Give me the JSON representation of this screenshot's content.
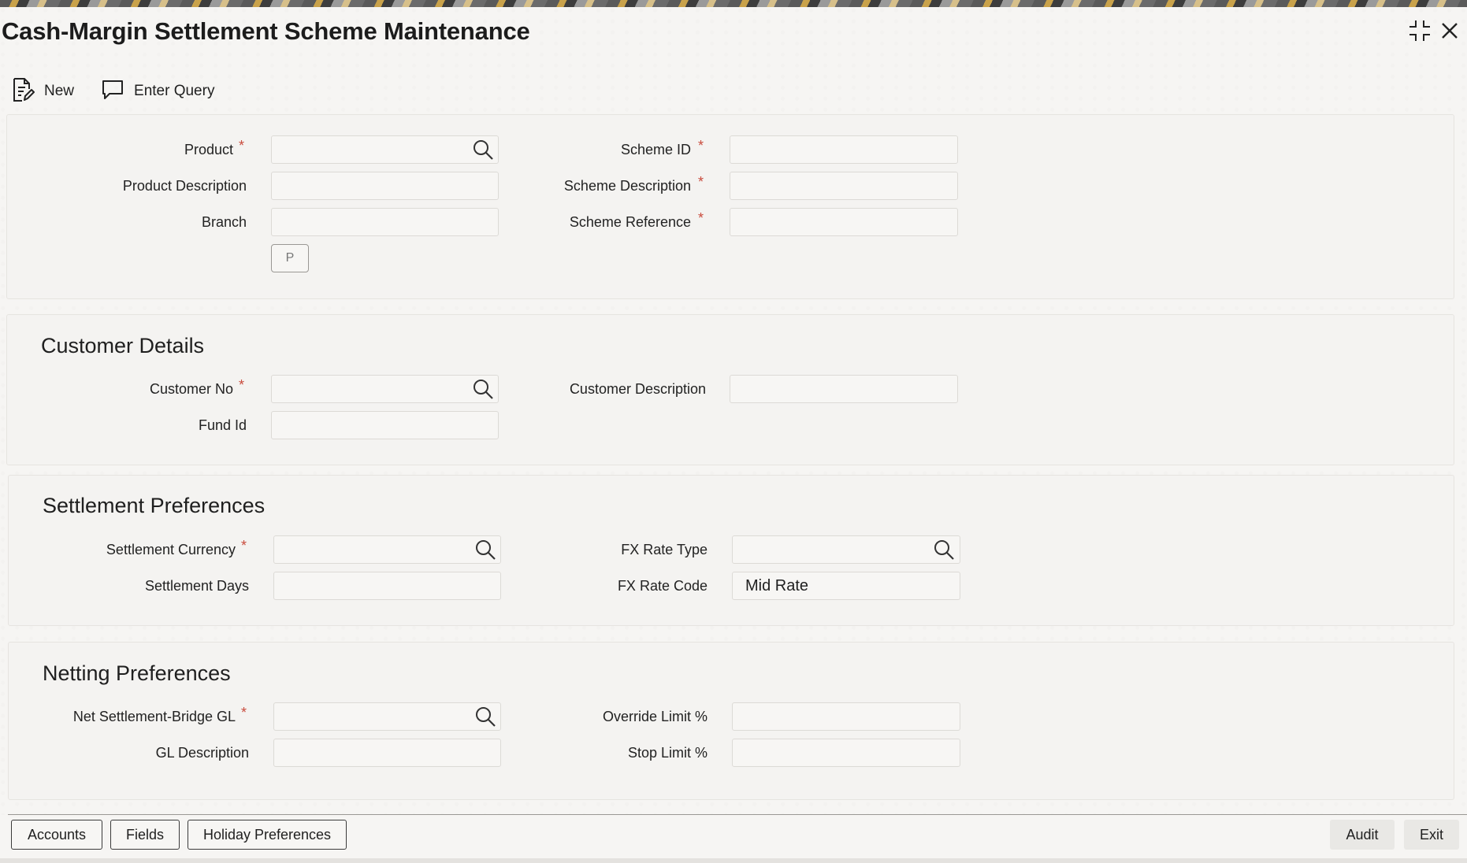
{
  "window": {
    "title": "Cash-Margin Settlement Scheme Maintenance"
  },
  "toolbar": {
    "new_label": "New",
    "enter_query_label": "Enter Query"
  },
  "header_panel": {
    "product_label": "Product",
    "product_value": "",
    "product_description_label": "Product Description",
    "product_description_value": "",
    "branch_label": "Branch",
    "branch_value": "",
    "p_button_label": "P",
    "scheme_id_label": "Scheme ID",
    "scheme_id_value": "",
    "scheme_description_label": "Scheme Description",
    "scheme_description_value": "",
    "scheme_reference_label": "Scheme Reference",
    "scheme_reference_value": ""
  },
  "customer_details": {
    "title": "Customer Details",
    "customer_no_label": "Customer No",
    "customer_no_value": "",
    "fund_id_label": "Fund Id",
    "fund_id_value": "",
    "customer_description_label": "Customer Description",
    "customer_description_value": ""
  },
  "settlement_preferences": {
    "title": "Settlement Preferences",
    "settlement_currency_label": "Settlement Currency",
    "settlement_currency_value": "",
    "settlement_days_label": "Settlement Days",
    "settlement_days_value": "",
    "fx_rate_type_label": "FX Rate Type",
    "fx_rate_type_value": "",
    "fx_rate_code_label": "FX Rate Code",
    "fx_rate_code_value": "Mid Rate"
  },
  "netting_preferences": {
    "title": "Netting Preferences",
    "net_settlement_bridge_gl_label": "Net Settlement-Bridge GL",
    "net_settlement_bridge_gl_value": "",
    "gl_description_label": "GL Description",
    "gl_description_value": "",
    "override_limit_label": "Override Limit %",
    "override_limit_value": "",
    "stop_limit_label": "Stop Limit %",
    "stop_limit_value": ""
  },
  "required_marker": "*",
  "footer": {
    "accounts_label": "Accounts",
    "fields_label": "Fields",
    "holiday_preferences_label": "Holiday Preferences",
    "audit_label": "Audit",
    "exit_label": "Exit"
  },
  "colors": {
    "required": "#c94b3d",
    "panel_background": "#f4f3f1",
    "page_background": "#f6f5f3"
  },
  "icons": {
    "new": "document-edit-icon",
    "enter_query": "speech-bubble-icon",
    "lookup": "search-icon",
    "maximize": "expand-icon",
    "close": "close-icon"
  }
}
